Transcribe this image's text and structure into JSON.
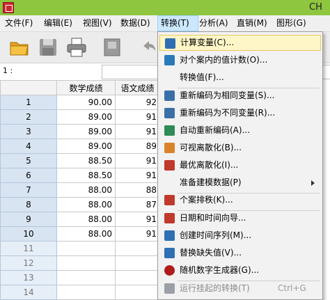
{
  "window": {
    "title": "CH"
  },
  "menubar": {
    "items": [
      "文件(F)",
      "编辑(E)",
      "视图(V)",
      "数据(D)",
      "转换(T)",
      "分析(A)",
      "直销(M)",
      "图形(G)"
    ],
    "active_index": 4
  },
  "toolbar": {
    "icons": [
      "open-folder-icon",
      "save-disk-icon",
      "print-icon",
      "dialog-recall-icon",
      "undo-icon"
    ]
  },
  "cell_editor": {
    "ref": "1 :",
    "value": ""
  },
  "grid": {
    "columns": [
      "数学成绩",
      "语文成绩"
    ],
    "rows": [
      {
        "row": "1",
        "math": "90.00",
        "chinese": "92"
      },
      {
        "row": "2",
        "math": "89.00",
        "chinese": "91"
      },
      {
        "row": "3",
        "math": "89.00",
        "chinese": "91"
      },
      {
        "row": "4",
        "math": "89.00",
        "chinese": "89"
      },
      {
        "row": "5",
        "math": "88.50",
        "chinese": "91"
      },
      {
        "row": "6",
        "math": "88.50",
        "chinese": "91"
      },
      {
        "row": "7",
        "math": "88.00",
        "chinese": "88"
      },
      {
        "row": "8",
        "math": "88.00",
        "chinese": "87"
      },
      {
        "row": "9",
        "math": "88.00",
        "chinese": "91"
      },
      {
        "row": "10",
        "math": "88.00",
        "chinese": "91"
      },
      {
        "row": "11",
        "math": "",
        "chinese": ""
      },
      {
        "row": "12",
        "math": "",
        "chinese": ""
      },
      {
        "row": "13",
        "math": "",
        "chinese": ""
      },
      {
        "row": "14",
        "math": "",
        "chinese": ""
      }
    ]
  },
  "transform_menu": {
    "items": [
      {
        "label": "计算变量(C)...",
        "icon": "compute-variable-icon",
        "color": "#2f6fb3"
      },
      {
        "label": "对个案内的值计数(O)...",
        "icon": "count-values-icon",
        "color": "#2a7ab8"
      },
      {
        "label": "转换值(F)...",
        "icon": "",
        "color": ""
      },
      {
        "label": "重新编码为相同变量(S)...",
        "icon": "recode-same-icon",
        "color": "#3b6fa8"
      },
      {
        "label": "重新编码为不同变量(R)...",
        "icon": "recode-different-icon",
        "color": "#3b6fa8"
      },
      {
        "label": "自动重新编码(A)...",
        "icon": "automatic-recode-icon",
        "color": "#2e8b57"
      },
      {
        "label": "可视离散化(B)...",
        "icon": "visual-binning-icon",
        "color": "#d9822b"
      },
      {
        "label": "最优离散化(I)...",
        "icon": "optimal-binning-icon",
        "color": "#c0392b"
      },
      {
        "label": "准备建模数据(P)",
        "icon": "",
        "color": ""
      },
      {
        "label": "个案排秩(K)...",
        "icon": "rank-cases-icon",
        "color": "#c0392b"
      },
      {
        "label": "日期和时间向导...",
        "icon": "date-time-wizard-icon",
        "color": "#c0392b"
      },
      {
        "label": "创建时间序列(M)...",
        "icon": "create-time-series-icon",
        "color": "#2f6fb3"
      },
      {
        "label": "替换缺失值(V)...",
        "icon": "replace-missing-icon",
        "color": "#2f6fb3"
      },
      {
        "label": "随机数字生成器(G)...",
        "icon": "random-number-icon",
        "color": "#b01c1c"
      },
      {
        "label": "运行挂起的转换(T)",
        "icon": "run-pending-icon",
        "color": "#9aa0a6"
      }
    ],
    "shortcut": "Ctrl+G",
    "highlight_color": "#fff6c7"
  }
}
